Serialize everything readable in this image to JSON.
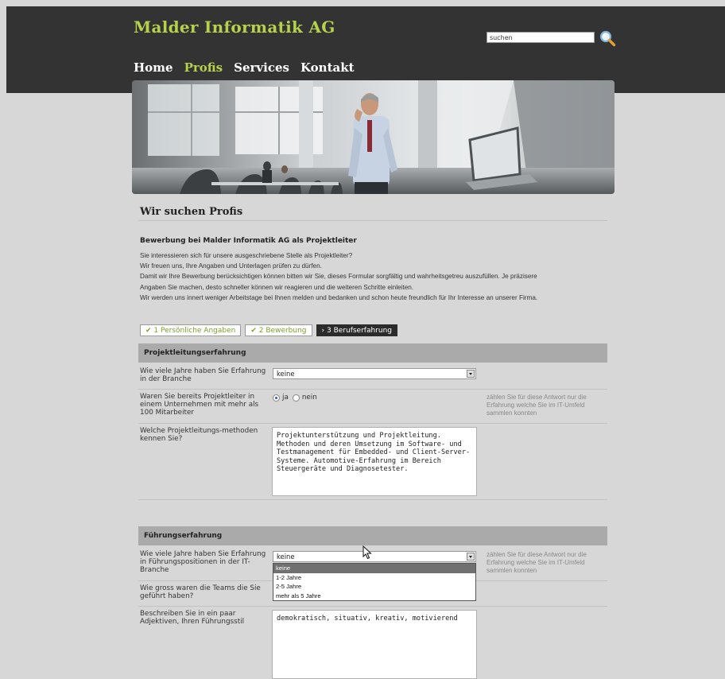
{
  "header": {
    "logo": "Malder Informatik AG",
    "search": {
      "value": "suchen"
    },
    "nav": [
      {
        "label": "Home",
        "active": false
      },
      {
        "label": "Profis",
        "active": true
      },
      {
        "label": "Services",
        "active": false
      },
      {
        "label": "Kontakt",
        "active": false
      }
    ]
  },
  "page": {
    "title": "Wir suchen Profis",
    "intro_heading": "Bewerbung bei Malder Informatik AG als Projektleiter",
    "intro_lines": [
      "Sie interessieren sich für unsere ausgeschriebene Stelle als Projektleiter?",
      "Wir freuen uns, Ihre Angaben und Unterlagen prüfen zu dürfen.",
      "Damit wir Ihre Bewerbung berücksichtigen können bitten wir Sie, dieses Formular sorgfältig und wahrheitsgetreu auszufüllen. Je präzisere",
      "Angaben Sie machen, desto schneller können wir reagieren und die weiteren Schritte einleiten.",
      "Wir werden uns innert weniger Arbeitstage bei Ihnen melden und bedanken und schon heute freundlich für Ihr Interesse an unserer Firma."
    ]
  },
  "steps": [
    {
      "icon": "✔",
      "label": "1 Persönliche Angaben",
      "state": "done"
    },
    {
      "icon": "✔",
      "label": "2 Bewerbung",
      "state": "done"
    },
    {
      "icon": "›",
      "label": "3 Berufserfahrung",
      "state": "current"
    }
  ],
  "sections": {
    "projekt": {
      "title": "Projektleitungserfahrung",
      "q1_label": "Wie viele Jahre haben Sie Erfahrung in der Branche",
      "q1_value": "keine",
      "q2_label": "Waren Sie bereits Projektleiter in einem Unternehmen mit mehr als 100 Mitarbeiter",
      "q2_yes": "ja",
      "q2_no": "nein",
      "q2_selected": "ja",
      "q2_hint": "zählen Sie für diese Antwort nur die Erfahrung welche Sie im IT-Umfeld sammlen konnten",
      "q3_label": "Welche Projektleitungs-methoden kennen Sie?",
      "q3_value": "Projektunterstützung und Projektleitung. Methoden und deren Umsetzung im Software- und Testmanagement für Embedded- und Client-Server-Systeme. Automotive-Erfahrung im Bereich Steuergeräte und Diagnosetester."
    },
    "fuehrung": {
      "title": "Führungserfahrung",
      "q1_label": "Wie viele Jahre haben Sie Erfahrung in Führungspositionen in der IT-Branche",
      "q1_value": "keine",
      "q1_hint": "zählen Sie für diese Antwort nur die Erfahrung welche Sie im IT-Umfeld sammlen konnten",
      "q1_options": [
        "keine",
        "1-2 Jahre",
        "2-5 Jahre",
        "mehr als 5 Jahre"
      ],
      "q2_label": "Wie gross waren die Teams die Sie geführt haben?",
      "q3_label": "Beschreiben Sie in ein paar Adjektiven, Ihren Führungsstil",
      "q3_value": "demokratisch, situativ, kreativ, motivierend"
    }
  },
  "colors": {
    "accent": "#b6d24b",
    "header_bg": "#333333",
    "page_bg": "#d7d7d7",
    "section_header_bg": "#aaaaaa",
    "step_done_text": "#7aa12a"
  }
}
